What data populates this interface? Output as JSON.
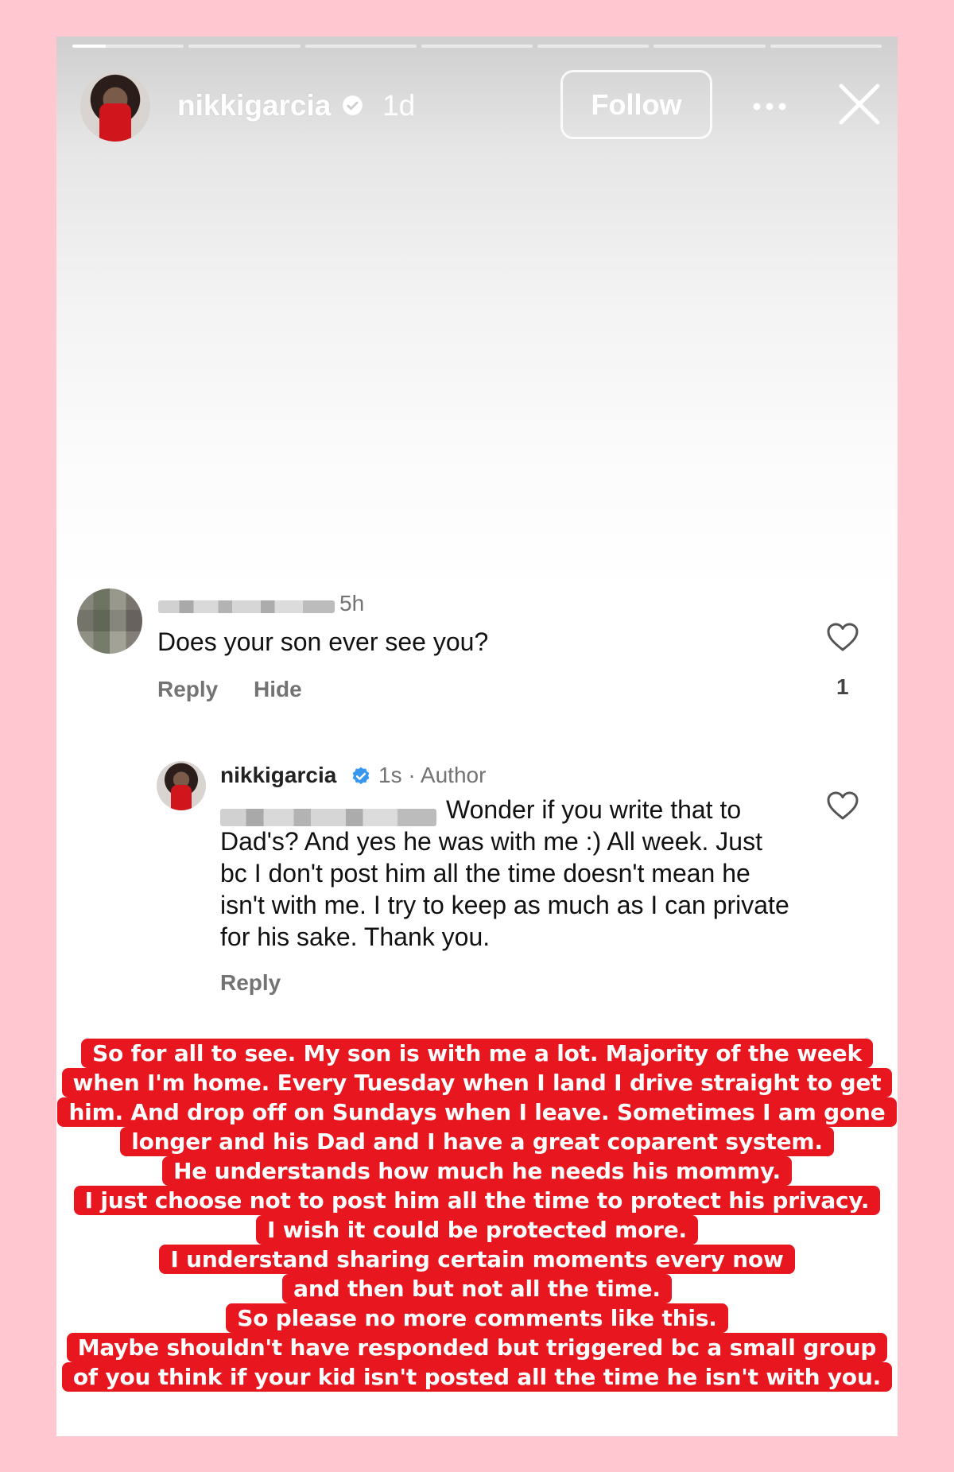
{
  "story": {
    "progress_segments": 7,
    "active_segment": 1,
    "username": "nikkigarcia",
    "time": "1d",
    "follow_label": "Follow"
  },
  "comment": {
    "time": "5h",
    "text": "Does your son ever see you?",
    "reply_label": "Reply",
    "hide_label": "Hide",
    "like_count": "1"
  },
  "reply": {
    "username": "nikkigarcia",
    "meta": "1s · Author",
    "text_line1": "Wonder if you write that to",
    "text_rest": "Dad's? And yes he was with me :) All week. Just bc I don't post him all the time doesn't mean he isn't with me. I try to keep as much as I can private for his sake. Thank you.",
    "reply_label": "Reply"
  },
  "caption": {
    "lines": [
      "So for all to see. My son is with me a lot. Majority of the week",
      "when I'm home. Every Tuesday when I land I drive straight to get",
      "him. And drop off on Sundays when I leave. Sometimes I am gone",
      "longer and his Dad and I have a great coparent system.",
      "He understands how much he needs his mommy.",
      "I just choose not to post him all the time to protect his privacy.",
      "I wish it could be protected more.",
      "I understand sharing certain moments every now",
      "and then but not all the time.",
      "So please no more comments like this.",
      "Maybe shouldn't have responded but triggered bc a small group",
      "of you think if your kid isn't posted all the time he isn't with you."
    ],
    "background_color": "#e8161f"
  },
  "colors": {
    "page_background": "#ffc8d0",
    "verified_blue": "#3897f0",
    "muted_text": "#737373"
  }
}
